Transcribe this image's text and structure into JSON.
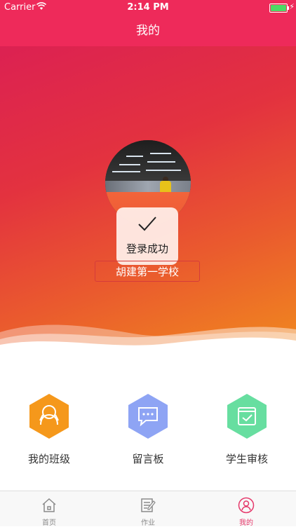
{
  "status_bar": {
    "carrier": "Carrier",
    "time": "2:14 PM"
  },
  "nav": {
    "title": "我的"
  },
  "profile": {
    "toast_message": "登录成功",
    "school_name": "胡建第一学校"
  },
  "menu": [
    {
      "label": "我的班级",
      "icon": "class-icon",
      "color": "#f5981b"
    },
    {
      "label": "留言板",
      "icon": "message-board-icon",
      "color": "#8ea4f4"
    },
    {
      "label": "学生审核",
      "icon": "student-review-icon",
      "color": "#67dea0"
    }
  ],
  "tabs": [
    {
      "label": "首页",
      "icon": "home-icon"
    },
    {
      "label": "作业",
      "icon": "homework-icon"
    },
    {
      "label": "我的",
      "icon": "profile-icon",
      "active": true
    }
  ],
  "colors": {
    "accent": "#ee2a5a",
    "active_tab": "#e5386a"
  }
}
